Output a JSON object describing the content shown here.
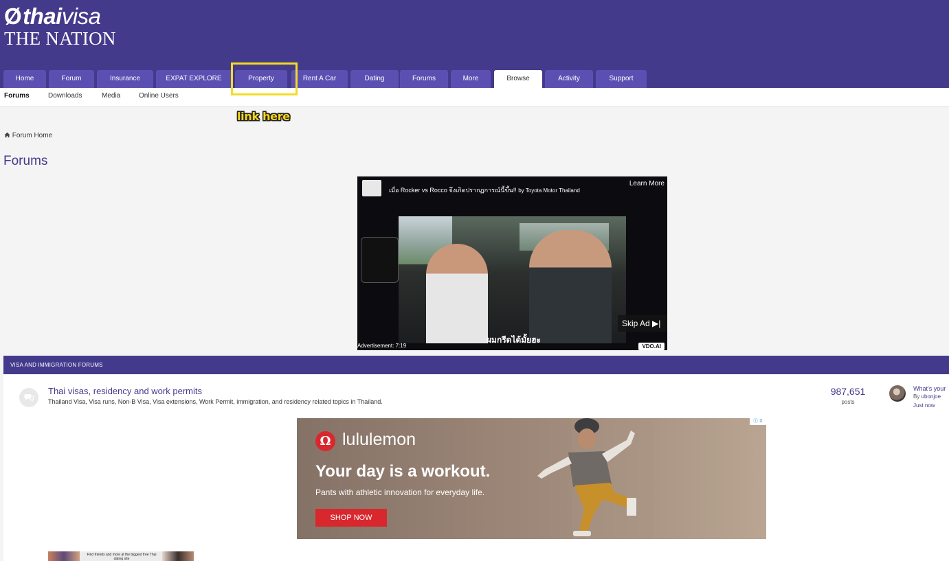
{
  "logo": {
    "top": "thaivisa",
    "top_bold": "thai",
    "top_light": "visa",
    "bottom": "THE NATION"
  },
  "nav": {
    "tabs": [
      {
        "label": "Home"
      },
      {
        "label": "Forum"
      },
      {
        "label": "Insurance"
      },
      {
        "label": "EXPAT EXPLORE"
      },
      {
        "label": "Property"
      },
      {
        "label": "Rent A Car"
      },
      {
        "label": "Dating"
      },
      {
        "label": "Forums"
      },
      {
        "label": "More"
      },
      {
        "label": "Browse",
        "active": true
      },
      {
        "label": "Activity"
      },
      {
        "label": "Support"
      }
    ]
  },
  "subnav": {
    "items": [
      {
        "label": "Forums",
        "active": true
      },
      {
        "label": "Downloads"
      },
      {
        "label": "Media"
      },
      {
        "label": "Online Users"
      }
    ]
  },
  "annotation": {
    "text": "link here",
    "color": "#f5dc24"
  },
  "breadcrumb": {
    "home": "Forum Home",
    "icon": "home-icon"
  },
  "page": {
    "title": "Forums"
  },
  "video_ad": {
    "title": "เมื่อ Rocker vs Rocco จึงเกิดปรากฏการณ์นี้ขึ้น!!",
    "by": "by Toyota Motor Thailand",
    "learn_more": "Learn More",
    "skip": "Skip Ad ▶|",
    "subtitle": "ผมกรีดได้มั้ยฮะ",
    "ad_label": "Advertisement: 7:19",
    "badge": "VDO.AI"
  },
  "section": {
    "header": "VISA AND IMMIGRATION FORUMS",
    "forum": {
      "title": "Thai visas, residency and work permits",
      "description": "Thailand Visa, Visa runs, Non-B Visa, Visa extensions, Work Permit, immigration, and residency related topics in Thailand.",
      "posts": "987,651",
      "posts_label": "posts",
      "last_post": {
        "title": "What's your",
        "by_prefix": "By ",
        "user": "ubonjoe",
        "time": "Just now"
      }
    }
  },
  "banner_ad": {
    "brand": "lululemon",
    "headline": "Your day is a workout.",
    "subline": "Pants with athletic innovation for everyday life.",
    "cta": "SHOP NOW",
    "adchoices": "ⓘ X"
  },
  "small_ad": {
    "text": "Find friends and more at the biggest free Thai dating site"
  },
  "colors": {
    "brand": "#443a8c",
    "tab": "#5b50b2",
    "highlight": "#f5dc24",
    "cta": "#d8282e"
  }
}
